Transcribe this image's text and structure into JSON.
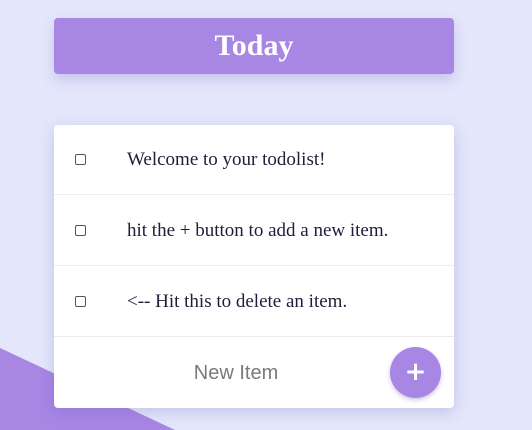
{
  "heading": {
    "title": "Today"
  },
  "items": [
    {
      "text": "Welcome to your todolist!",
      "checked": false
    },
    {
      "text": "hit the + button to add a new item.",
      "checked": false
    },
    {
      "text": "<-- Hit this to delete an item.",
      "checked": false
    }
  ],
  "new_item": {
    "placeholder": "New Item",
    "value": "",
    "add_label": "+"
  },
  "colors": {
    "background": "#e4e6fb",
    "accent": "#a786e4",
    "card": "#ffffff",
    "text": "#1c1f3a"
  }
}
